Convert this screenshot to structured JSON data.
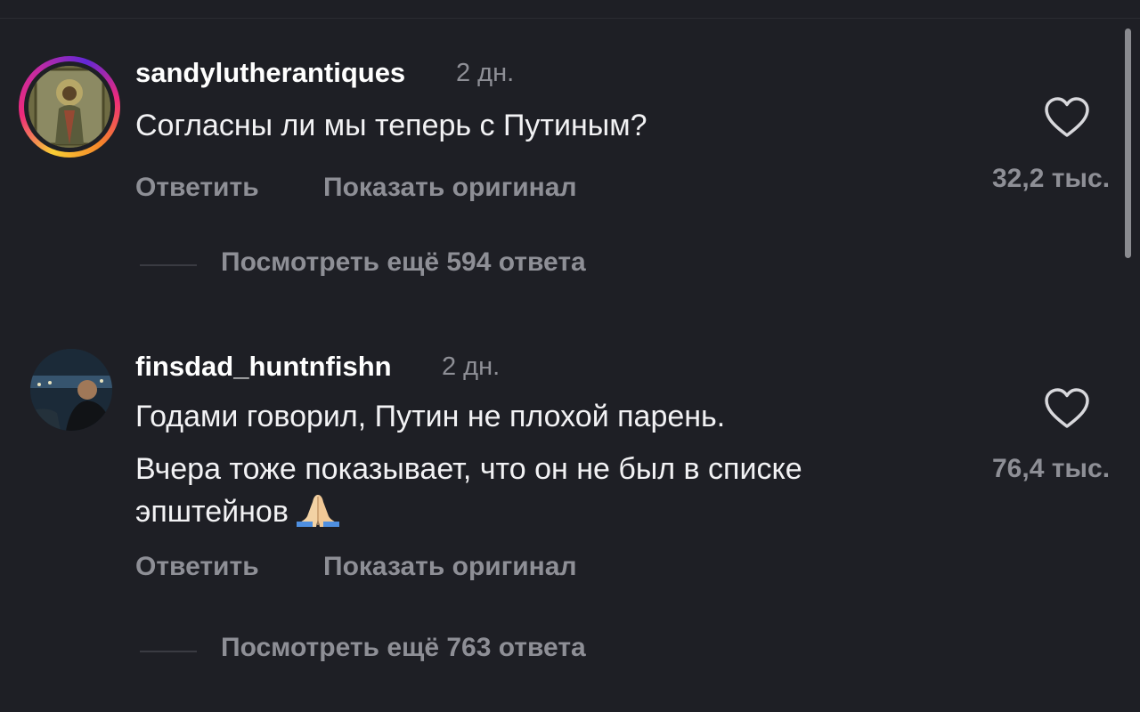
{
  "comments": [
    {
      "username": "sandylutherantiques",
      "time": "2 дн.",
      "lines": [
        "Согласны ли мы теперь с Путиным?"
      ],
      "reply_label": "Ответить",
      "show_original_label": "Показать оригинал",
      "likes": "32,2 тыс.",
      "view_replies": "Посмотреть ещё 594 ответа",
      "avatar_ring": true
    },
    {
      "username": "finsdad_huntnfishn",
      "time": "2 дн.",
      "lines": [
        "Годами говорил, Путин не плохой парень.",
        "Вчера тоже показывает, что он не был в списке",
        "эпштейнов"
      ],
      "emoji": "folded-hands",
      "reply_label": "Ответить",
      "show_original_label": "Показать оригинал",
      "likes": "76,4 тыс.",
      "view_replies": "Посмотреть ещё 763 ответа",
      "avatar_ring": false
    }
  ],
  "colors": {
    "background": "#1e1f25",
    "primary_text": "#f2f2f4",
    "secondary_text": "#8e8f96"
  }
}
